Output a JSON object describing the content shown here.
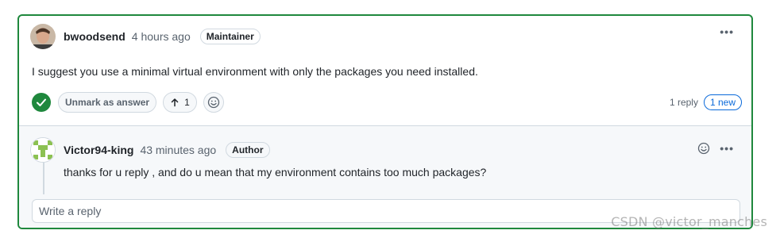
{
  "answer": {
    "author": "bwoodsend",
    "time": "4 hours ago",
    "role": "Maintainer",
    "body": "I suggest you use a minimal virtual environment with only the packages you need installed.",
    "unmark_label": "Unmark as answer",
    "upvotes": "1",
    "replies": "1 reply",
    "new_label": "1 new",
    "accent_color": "#1f883d"
  },
  "reply": {
    "author": "Victor94-king",
    "time": "43 minutes ago",
    "role": "Author",
    "body": "thanks for u reply , and do u mean that my environment contains too much packages?"
  },
  "reply_input": {
    "placeholder": "Write a reply"
  },
  "watermark": "CSDN @victor_manches"
}
